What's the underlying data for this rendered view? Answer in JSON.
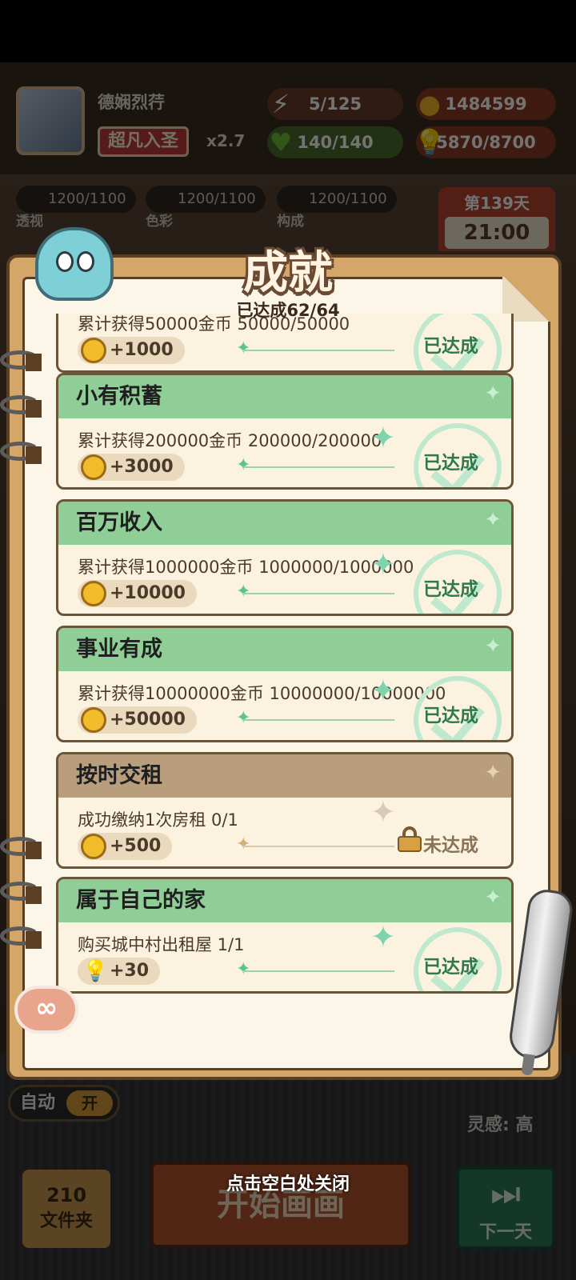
{
  "hud": {
    "player_name": "德娴烈荇",
    "rank": "超凡入圣",
    "multiplier": "x2.7",
    "energy": "5/125",
    "health": "140/140",
    "gold": "1484599",
    "inspiration_points": "5870/8700"
  },
  "skills": [
    {
      "value": "1200/1100",
      "label": "透视"
    },
    {
      "value": "1200/1100",
      "label": "色彩"
    },
    {
      "value": "1200/1100",
      "label": "构成"
    }
  ],
  "day": {
    "label": "第139天",
    "time": "21:00"
  },
  "bottom": {
    "auto_label": "自动",
    "auto_state": "开",
    "inspiration_label": "灵感:",
    "inspiration_value": "高",
    "folder_count": "210",
    "folder_label": "文件夹",
    "start_label": "开始画画",
    "next_label": "下一天",
    "close_hint": "点击空白处关闭"
  },
  "panel": {
    "title": "成就",
    "progress": "已达成62/64"
  },
  "achievements": [
    {
      "title": "",
      "desc": "累计获得50000金币 50000/50000",
      "reward": "+1000",
      "reward_icon": "coin-icon",
      "status": "已达成",
      "done": true
    },
    {
      "title": "小有积蓄",
      "desc": "累计获得200000金币 200000/200000",
      "reward": "+3000",
      "reward_icon": "coin-icon",
      "status": "已达成",
      "done": true
    },
    {
      "title": "百万收入",
      "desc": "累计获得1000000金币 1000000/1000000",
      "reward": "+10000",
      "reward_icon": "coin-icon",
      "status": "已达成",
      "done": true
    },
    {
      "title": "事业有成",
      "desc": "累计获得10000000金币 10000000/10000000",
      "reward": "+50000",
      "reward_icon": "coin-icon",
      "status": "已达成",
      "done": true
    },
    {
      "title": "按时交租",
      "desc": "成功缴纳1次房租 0/1",
      "reward": "+500",
      "reward_icon": "coin-icon",
      "status": "未达成",
      "done": false
    },
    {
      "title": "属于自己的家",
      "desc": "购买城中村出租屋 1/1",
      "reward": "+30",
      "reward_icon": "bulb-icon",
      "status": "已达成",
      "done": true
    }
  ],
  "colors": {
    "done_header": "#8fce96",
    "locked_header": "#b99e7e",
    "done_status": "#2f7a4c",
    "panel_frame": "#d4a667"
  }
}
